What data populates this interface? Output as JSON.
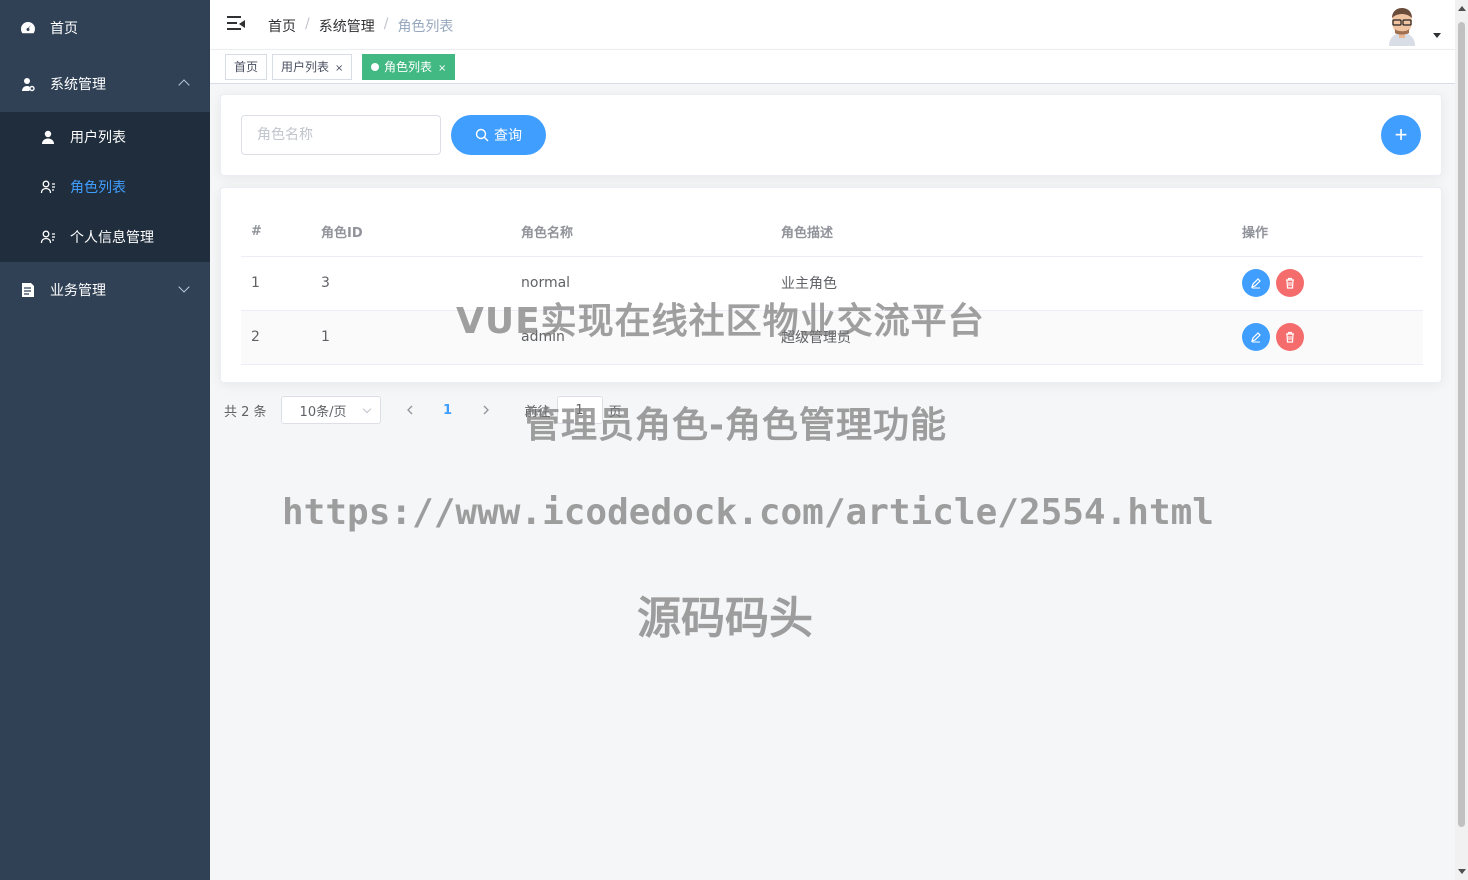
{
  "sidebar": {
    "home": "首页",
    "system_mgmt": "系统管理",
    "sub_items": [
      "用户列表",
      "角色列表",
      "个人信息管理"
    ],
    "business_mgmt": "业务管理"
  },
  "header": {
    "breadcrumb": [
      "首页",
      "系统管理",
      "角色列表"
    ]
  },
  "tags": [
    {
      "label": "首页"
    },
    {
      "label": "用户列表",
      "close": "×"
    },
    {
      "label": "角色列表",
      "close": "×"
    }
  ],
  "search": {
    "placeholder": "角色名称",
    "query_label": "查询",
    "add_label": "+"
  },
  "table": {
    "headers": [
      "#",
      "角色ID",
      "角色名称",
      "角色描述",
      "操作"
    ],
    "rows": [
      {
        "index": "1",
        "id": "3",
        "name": "normal",
        "desc": "业主角色"
      },
      {
        "index": "2",
        "id": "1",
        "name": "admin",
        "desc": "超级管理员"
      }
    ]
  },
  "pagination": {
    "total": "共 2 条",
    "page_size": "10条/页",
    "current": "1",
    "goto_prefix": "前往",
    "goto_value": "1",
    "goto_suffix": "页"
  },
  "watermark": {
    "line1": "VUE实现在线社区物业交流平台",
    "line2": "管理员角色-角色管理功能",
    "line3": "https://www.icodedock.com/article/2554.html",
    "line4": "源码码头"
  },
  "colors": {
    "sidebar_bg": "#304156",
    "submenu_bg": "#1f2d3d",
    "primary": "#409eff",
    "active_tag": "#42b983",
    "danger": "#f56c6c"
  }
}
